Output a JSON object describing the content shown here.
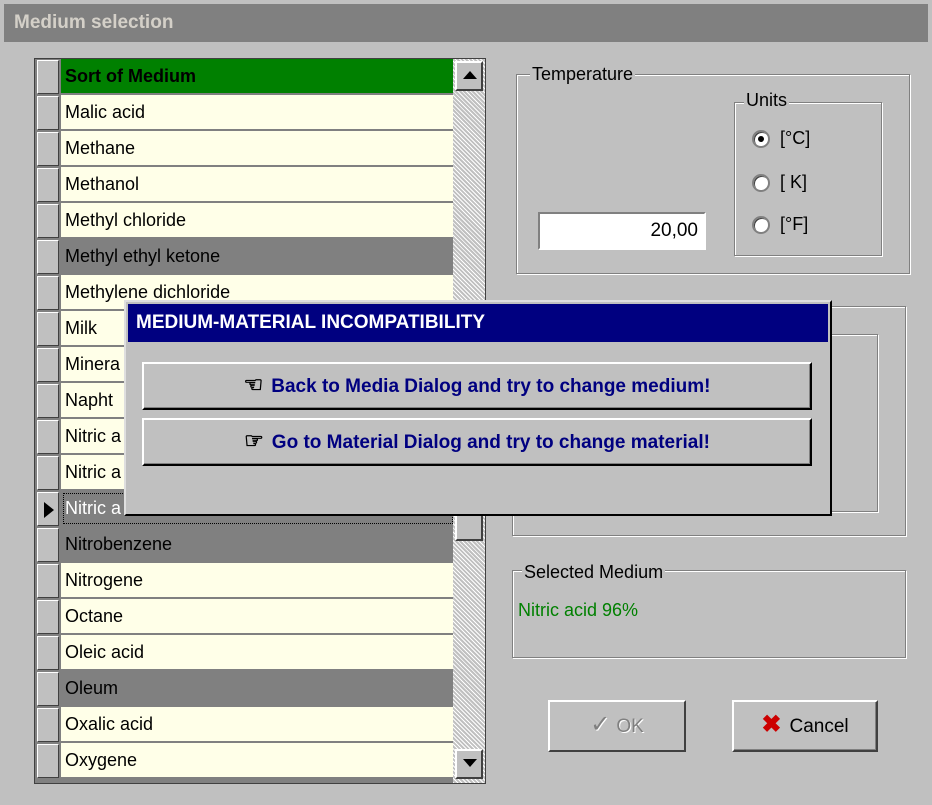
{
  "window": {
    "title": "Medium selection"
  },
  "grid": {
    "header": "Sort of Medium",
    "rows": [
      {
        "label": "Malic acid",
        "state": "normal"
      },
      {
        "label": "Methane",
        "state": "normal"
      },
      {
        "label": "Methanol",
        "state": "normal"
      },
      {
        "label": "Methyl chloride",
        "state": "normal"
      },
      {
        "label": "Methyl ethyl ketone",
        "state": "highlight"
      },
      {
        "label": "Methylene dichloride",
        "state": "normal"
      },
      {
        "label": "Milk",
        "state": "normal"
      },
      {
        "label": "Minera",
        "state": "normal"
      },
      {
        "label": "Napht",
        "state": "normal"
      },
      {
        "label": "Nitric a",
        "state": "normal"
      },
      {
        "label": "Nitric a",
        "state": "normal"
      },
      {
        "label": "Nitric a",
        "state": "selected"
      },
      {
        "label": "Nitrobenzene",
        "state": "highlight"
      },
      {
        "label": "Nitrogene",
        "state": "normal"
      },
      {
        "label": "Octane",
        "state": "normal"
      },
      {
        "label": "Oleic acid",
        "state": "normal"
      },
      {
        "label": "Oleum",
        "state": "highlight"
      },
      {
        "label": "Oxalic acid",
        "state": "normal"
      },
      {
        "label": "Oxygene",
        "state": "normal"
      }
    ]
  },
  "temperature": {
    "group_label": "Temperature",
    "value": "20,00",
    "units_label": "Units",
    "units": [
      {
        "label": "[°C]",
        "checked": true
      },
      {
        "label": "[ K]",
        "checked": false
      },
      {
        "label": "[°F]",
        "checked": false
      }
    ]
  },
  "selected_medium": {
    "group_label": "Selected Medium",
    "value": "Nitric acid 96%",
    "value_color": "#008000"
  },
  "buttons": {
    "ok": "OK",
    "cancel": "Cancel"
  },
  "modal": {
    "title": "MEDIUM-MATERIAL INCOMPATIBILITY",
    "back_label": "Back to Media Dialog and try to change medium!",
    "go_label": "Go to Material Dialog and try to change material!"
  },
  "colors": {
    "header_green": "#008000",
    "modal_title_bg": "#000080",
    "row_bg": "#ffffe8",
    "highlight_row": "#808080",
    "cancel_x": "#cc0000"
  }
}
